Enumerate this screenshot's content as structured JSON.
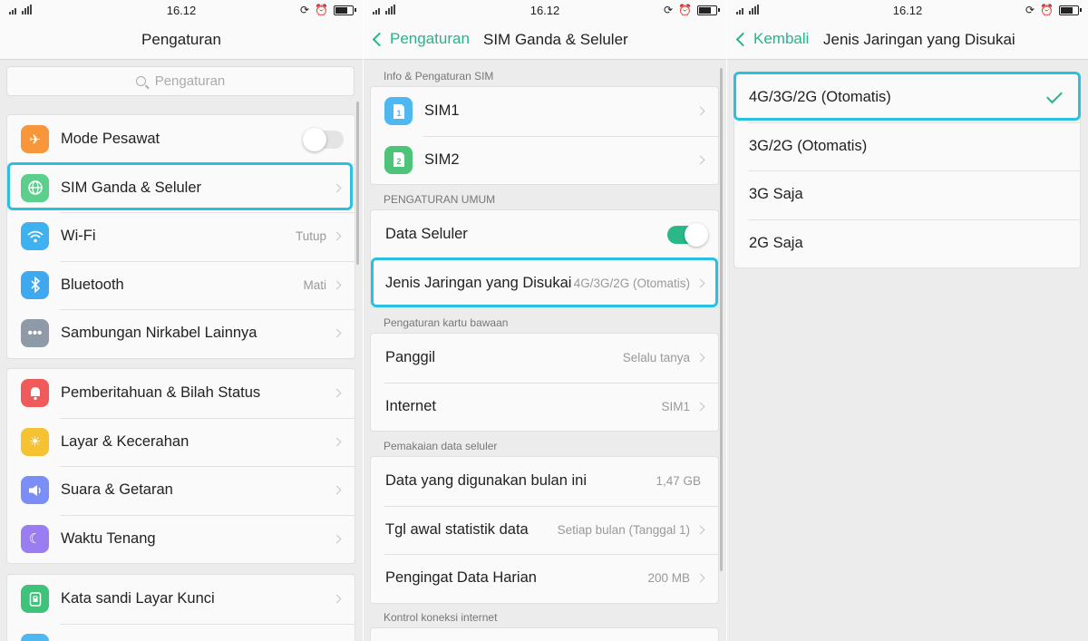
{
  "status": {
    "time": "16.12"
  },
  "panel1": {
    "title": "Pengaturan",
    "search_placeholder": "Pengaturan",
    "items": [
      {
        "label": "Mode Pesawat",
        "value": "",
        "icon": "airplane-icon",
        "color": "#f7963a"
      },
      {
        "label": "SIM Ganda & Seluler",
        "value": "",
        "icon": "globe-icon",
        "color": "#5ccf8d"
      },
      {
        "label": "Wi-Fi",
        "value": "Tutup",
        "icon": "wifi-icon",
        "color": "#3fb1f0"
      },
      {
        "label": "Bluetooth",
        "value": "Mati",
        "icon": "bluetooth-icon",
        "color": "#3fa9f0"
      },
      {
        "label": "Sambungan Nirkabel Lainnya",
        "value": "",
        "icon": "more-icon",
        "color": "#8e9aa8"
      },
      {
        "label": "Pemberitahuan & Bilah Status",
        "value": "",
        "icon": "notification-icon",
        "color": "#f05a5a"
      },
      {
        "label": "Layar &  Kecerahan",
        "value": "",
        "icon": "brightness-icon",
        "color": "#f5c231"
      },
      {
        "label": "Suara & Getaran",
        "value": "",
        "icon": "speaker-icon",
        "color": "#7b8ef5"
      },
      {
        "label": "Waktu Tenang",
        "value": "",
        "icon": "moon-icon",
        "color": "#9a7df0"
      },
      {
        "label": "Kata sandi Layar Kunci",
        "value": "",
        "icon": "lock-icon",
        "color": "#3fc279"
      }
    ]
  },
  "panel2": {
    "back_label": "Pengaturan",
    "title": "SIM Ganda & Seluler",
    "sections": [
      "Info & Pengaturan SIM",
      "PENGATURAN UMUM",
      "Pengaturan kartu bawaan",
      "Pemakaian data seluler",
      "Kontrol koneksi internet"
    ],
    "sim": [
      {
        "label": "SIM1",
        "badge": "1",
        "color": "#4fb8f0"
      },
      {
        "label": "SIM2",
        "badge": "2",
        "color": "#4dc47a"
      }
    ],
    "general": [
      {
        "label": "Data Seluler",
        "value": ""
      },
      {
        "label": "Jenis Jaringan yang Disukai",
        "value": "4G/3G/2G (Otomatis)"
      }
    ],
    "default_card": [
      {
        "label": "Panggil",
        "value": "Selalu tanya"
      },
      {
        "label": "Internet",
        "value": "SIM1"
      }
    ],
    "data_usage": [
      {
        "label": "Data yang digunakan bulan ini",
        "value": "1,47 GB"
      },
      {
        "label": "Tgl awal statistik data",
        "value": "Setiap bulan (Tanggal 1)"
      },
      {
        "label": "Pengingat Data Harian",
        "value": "200 MB"
      }
    ]
  },
  "panel3": {
    "back_label": "Kembali",
    "title": "Jenis Jaringan yang Disukai",
    "options": [
      {
        "label": "4G/3G/2G (Otomatis)",
        "selected": true
      },
      {
        "label": "3G/2G (Otomatis)",
        "selected": false
      },
      {
        "label": "3G Saja",
        "selected": false
      },
      {
        "label": "2G Saja",
        "selected": false
      }
    ]
  }
}
